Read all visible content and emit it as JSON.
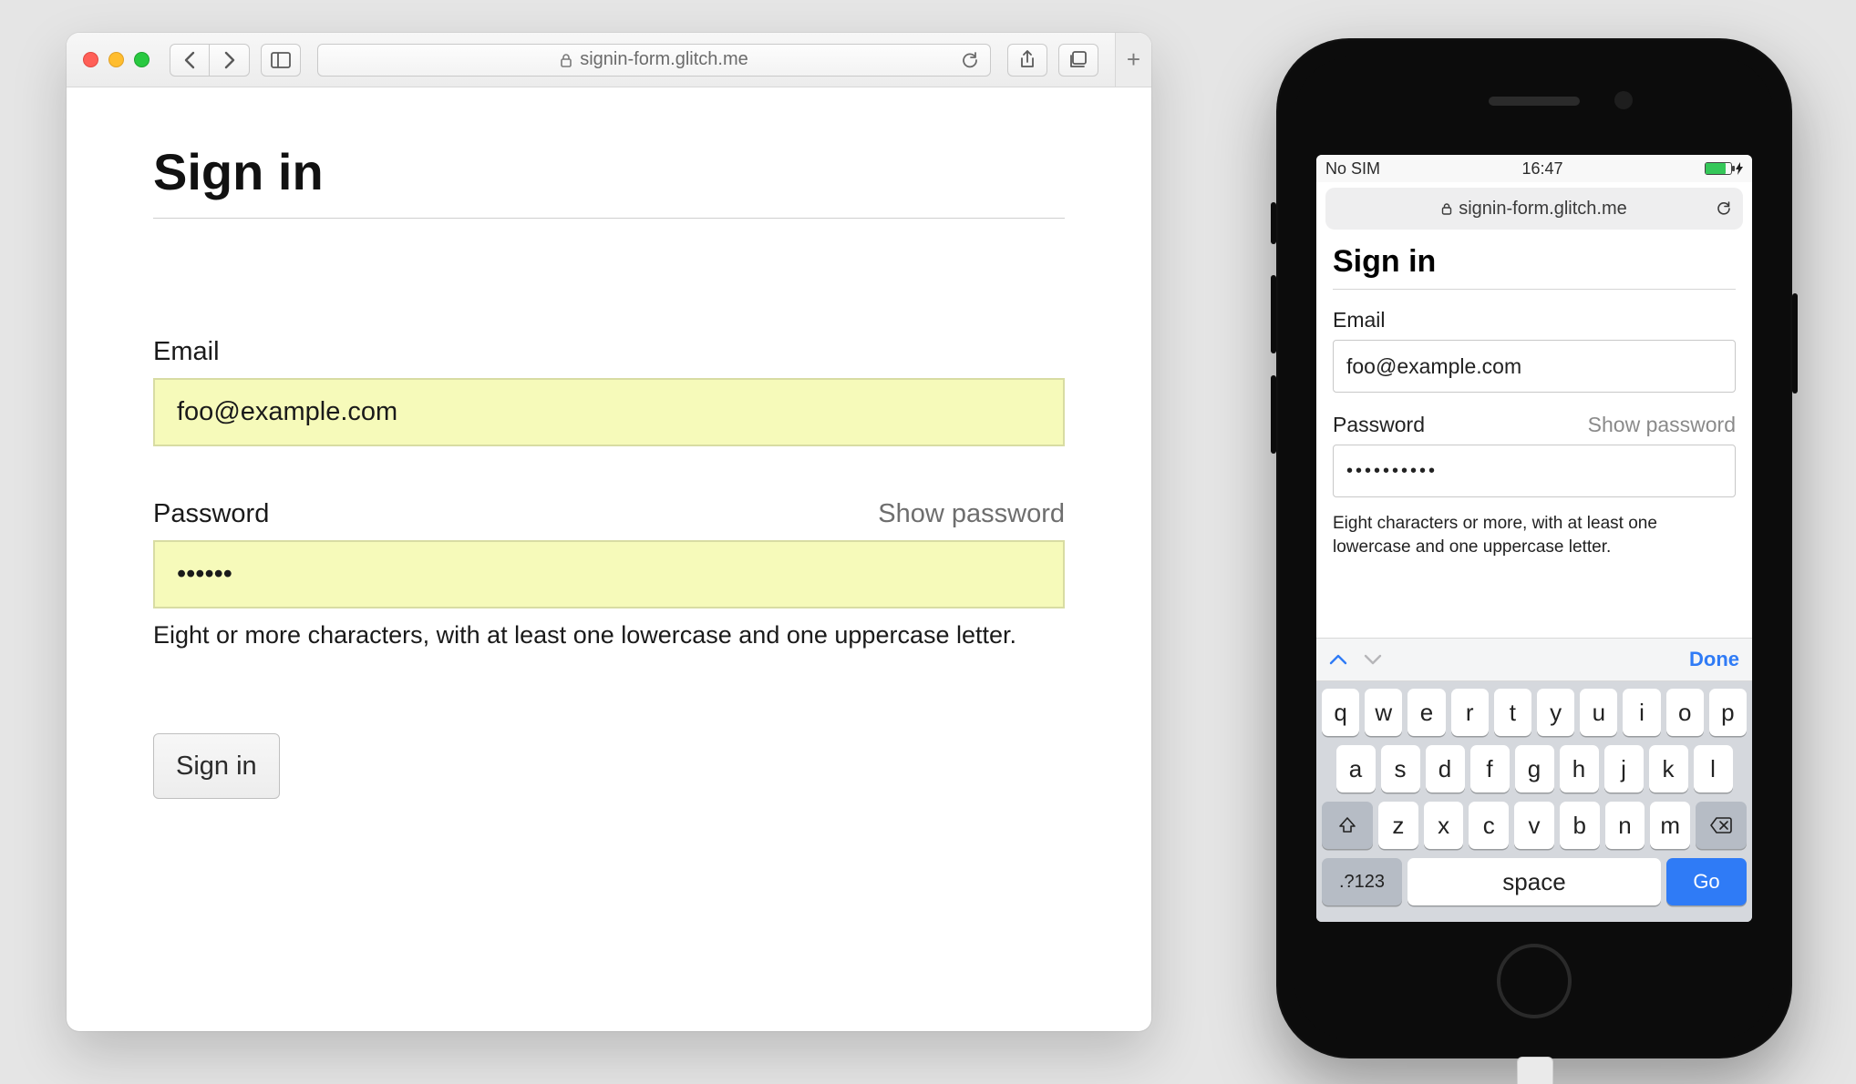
{
  "desktop": {
    "url": "signin-form.glitch.me",
    "page": {
      "title": "Sign in",
      "email_label": "Email",
      "email_value": "foo@example.com",
      "password_label": "Password",
      "show_password_label": "Show password",
      "password_value": "••••••",
      "password_hint": "Eight or more characters, with at least one lowercase and one uppercase letter.",
      "submit_label": "Sign in"
    }
  },
  "phone": {
    "status": {
      "carrier": "No SIM",
      "time": "16:47"
    },
    "url": "signin-form.glitch.me",
    "page": {
      "title": "Sign in",
      "email_label": "Email",
      "email_value": "foo@example.com",
      "password_label": "Password",
      "show_password_label": "Show password",
      "password_value": "••••••••••",
      "password_hint": "Eight characters or more, with at least one lowercase and one uppercase letter."
    },
    "keyboard": {
      "done_label": "Done",
      "row1": [
        "q",
        "w",
        "e",
        "r",
        "t",
        "y",
        "u",
        "i",
        "o",
        "p"
      ],
      "row2": [
        "a",
        "s",
        "d",
        "f",
        "g",
        "h",
        "j",
        "k",
        "l"
      ],
      "row3": [
        "z",
        "x",
        "c",
        "v",
        "b",
        "n",
        "m"
      ],
      "numbers_key": ".?123",
      "space_key": "space",
      "go_key": "Go"
    }
  }
}
